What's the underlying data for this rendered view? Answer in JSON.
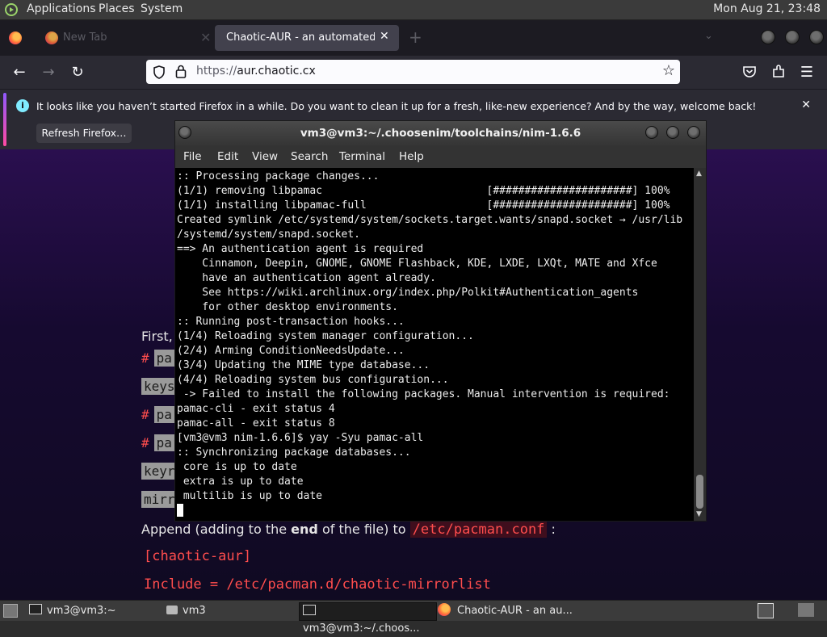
{
  "top_panel": {
    "menus": [
      "Applications",
      "Places",
      "System"
    ],
    "clock": "Mon Aug 21, 23:48"
  },
  "firefox": {
    "tabs": [
      {
        "label": "New Tab",
        "active": false
      },
      {
        "label": "Chaotic-AUR - an automated bu",
        "active": true
      }
    ],
    "new_tab_symbol": "+",
    "url": "https://aur.chaotic.cx",
    "url_host": "aur.chaotic.cx",
    "url_prefix": "https://",
    "notice": {
      "text": "It looks like you haven’t started Firefox in a while. Do you want to clean it up for a fresh, like-new experience? And by the way, welcome back!",
      "button": "Refresh Firefox…"
    },
    "page": {
      "first": "First,",
      "hash1": "#",
      "chip1": "pa",
      "chip2": "keys",
      "hash3": "#",
      "chip3": "pa",
      "hash4": "#",
      "chip4": "pa",
      "chip5": "keyr",
      "chip6": "mirr",
      "append_prefix": "Append (adding to the ",
      "append_bold": "end",
      "append_suffix": " of the file) to ",
      "append_path": "/etc/pacman.conf",
      "append_colon": ":",
      "section": "[chaotic-aur]",
      "include": "Include = /etc/pacman.d/chaotic-mirrorlist"
    }
  },
  "terminal": {
    "title": "vm3@vm3:~/.choosenim/toolchains/nim-1.6.6",
    "menus": [
      "File",
      "Edit",
      "View",
      "Search",
      "Terminal",
      "Help"
    ],
    "lines": [
      ":: Processing package changes...",
      "(1/1) removing libpamac                          [######################] 100%",
      "(1/1) installing libpamac-full                   [######################] 100%",
      "Created symlink /etc/systemd/system/sockets.target.wants/snapd.socket → /usr/lib",
      "/systemd/system/snapd.socket.",
      "==> An authentication agent is required",
      "    Cinnamon, Deepin, GNOME, GNOME Flashback, KDE, LXDE, LXQt, MATE and Xfce",
      "    have an authentication agent already.",
      "    See https://wiki.archlinux.org/index.php/Polkit#Authentication_agents",
      "    for other desktop environments.",
      ":: Running post-transaction hooks...",
      "(1/4) Reloading system manager configuration...",
      "(2/4) Arming ConditionNeedsUpdate...",
      "(3/4) Updating the MIME type database...",
      "(4/4) Reloading system bus configuration...",
      " -> Failed to install the following packages. Manual intervention is required:",
      "pamac-cli - exit status 4",
      "pamac-all - exit status 8",
      "[vm3@vm3 nim-1.6.6]$ yay -Syu pamac-all",
      ":: Synchronizing package databases...",
      " core is up to date",
      " extra is up to date",
      " multilib is up to date"
    ]
  },
  "taskbar": {
    "items": [
      {
        "label": "vm3@vm3:~",
        "active": false
      },
      {
        "label": "vm3",
        "active": false
      },
      {
        "label": "vm3@vm3:~/.choos...",
        "active": true
      },
      {
        "label": "Chaotic-AUR - an au...",
        "active": false
      }
    ]
  },
  "colors": {
    "panel": "#3b3b3b",
    "ff_tabstrip": "#1c1b22",
    "ff_toolbar": "#2b2a33",
    "page_bg": "#1a0c38",
    "code_red": "#ff4d4d",
    "terminal_bg": "#000000"
  }
}
